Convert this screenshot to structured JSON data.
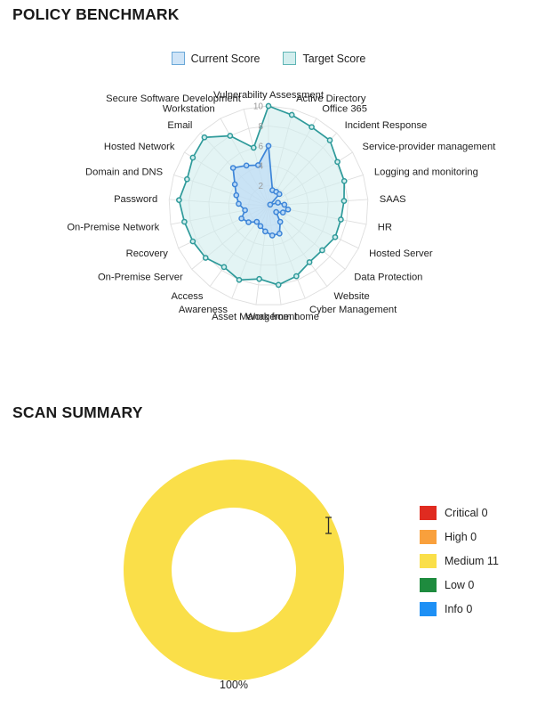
{
  "sections": {
    "policy_title": "POLICY BENCHMARK",
    "scan_title": "SCAN SUMMARY"
  },
  "radar_legend": [
    {
      "label": "Current Score",
      "color": "#cfe4f7",
      "border": "#6aa8d8"
    },
    {
      "label": "Target Score",
      "color": "#d2eeee",
      "border": "#5fb5b5"
    }
  ],
  "donut_label": "100%",
  "severity_legend": [
    {
      "label": "Critical 0",
      "color": "#e02b20"
    },
    {
      "label": "High 0",
      "color": "#f9a03c"
    },
    {
      "label": "Medium 11",
      "color": "#fadf49"
    },
    {
      "label": "Low 0",
      "color": "#1e8b3e"
    },
    {
      "label": "Info 0",
      "color": "#1e90f5"
    }
  ],
  "chart_data": [
    {
      "type": "radar",
      "title": "POLICY BENCHMARK",
      "ylim": [
        0,
        10
      ],
      "ticks": [
        2,
        4,
        6,
        8,
        10
      ],
      "grid": true,
      "legend_position": "top",
      "categories": [
        "Vulnerability Assessment",
        "Active Directory",
        "Office 365",
        "Incident Response",
        "Service-provider management",
        "Logging and monitoring",
        "SAAS",
        "HR",
        "Hosted Server",
        "Data Protection",
        "Website",
        "Cyber Management",
        "Work from home",
        "Asset Management",
        "Awareness",
        "Access",
        "On-Premise Server",
        "Recovery",
        "On-Premise Network",
        "Password",
        "Domain and DNS",
        "Hosted Network",
        "Email",
        "Workstation",
        "Secure Software Development"
      ],
      "series": [
        {
          "name": "Target Score",
          "color": "#2e9a9a",
          "fill": "#d2eeee",
          "values": [
            10,
            9.4,
            9.0,
            9.0,
            8.2,
            8.0,
            7.6,
            7.4,
            7.4,
            7.0,
            7.0,
            7.6,
            8.0,
            7.4,
            8.0,
            7.6,
            8.2,
            8.4,
            8.6,
            9.0,
            8.6,
            9.0,
            9.4,
            8.0,
            6.0
          ]
        },
        {
          "name": "Current Score",
          "color": "#3d85d8",
          "fill": "#b9d9f5",
          "values": [
            6.0,
            1.6,
            1.6,
            1.6,
            0.2,
            1.0,
            1.6,
            2.0,
            1.6,
            1.0,
            2.0,
            3.0,
            3.0,
            2.6,
            2.2,
            2.0,
            2.6,
            3.0,
            2.4,
            3.0,
            3.4,
            4.0,
            5.2,
            4.6,
            4.2
          ]
        }
      ]
    },
    {
      "type": "pie",
      "title": "SCAN SUMMARY",
      "variant": "donut",
      "labels": [
        "Medium"
      ],
      "values": [
        11
      ],
      "percentages": [
        100
      ],
      "colors": [
        "#fadf49"
      ],
      "legend_position": "right",
      "legend_entries": [
        {
          "label": "Critical",
          "value": 0,
          "color": "#e02b20"
        },
        {
          "label": "High",
          "value": 0,
          "color": "#f9a03c"
        },
        {
          "label": "Medium",
          "value": 11,
          "color": "#fadf49"
        },
        {
          "label": "Low",
          "value": 0,
          "color": "#1e8b3e"
        },
        {
          "label": "Info",
          "value": 0,
          "color": "#1e90f5"
        }
      ],
      "data_label": "100%"
    }
  ]
}
